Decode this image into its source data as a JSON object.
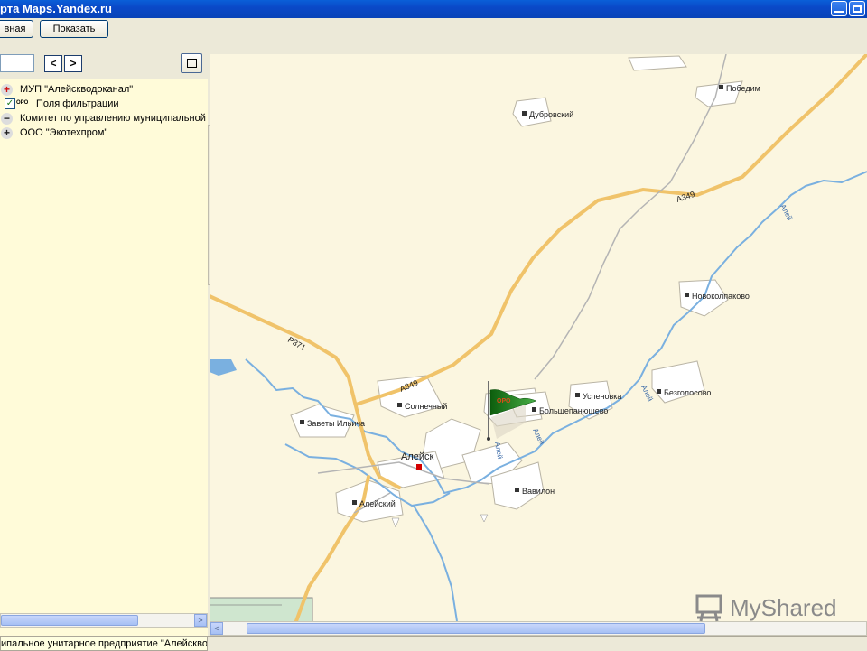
{
  "window": {
    "title": "рта Maps.Yandex.ru"
  },
  "toolbar": {
    "main_label": "вная",
    "show_label": "Показать"
  },
  "nav": {
    "prev_label": "<",
    "next_label": ">"
  },
  "tree": {
    "items": [
      {
        "label": "МУП \"Алейскводоканал\"",
        "expander": "+"
      },
      {
        "label": "Поля фильтрации",
        "tag": "ОРО"
      },
      {
        "label": "Комитет по управлению муниципальной",
        "expander": "−"
      },
      {
        "label": "ООО \"Экотехпром\"",
        "expander": "+"
      }
    ]
  },
  "status": {
    "text": "ипальное унитарное предприятие \"Алейскво"
  },
  "map": {
    "flag_label": "ОРО",
    "towns": [
      "Победим",
      "Дубровский",
      "Новоколпаково",
      "Успеновка",
      "Безголосово",
      "Большепанюшево",
      "Солнечный",
      "Заветы Ильича",
      "Алейск",
      "Алейский",
      "Вавилон"
    ],
    "roads": [
      "А349",
      "А349",
      "Р371"
    ],
    "rivers": [
      "Алей",
      "Алей",
      "Алей",
      "Алей"
    ],
    "colors": {
      "background": "#fbf6e0",
      "road": "#f0c36a",
      "river": "#7ab0e0",
      "settlement": "#ffffff"
    }
  },
  "watermark": {
    "text": "MyShared"
  }
}
